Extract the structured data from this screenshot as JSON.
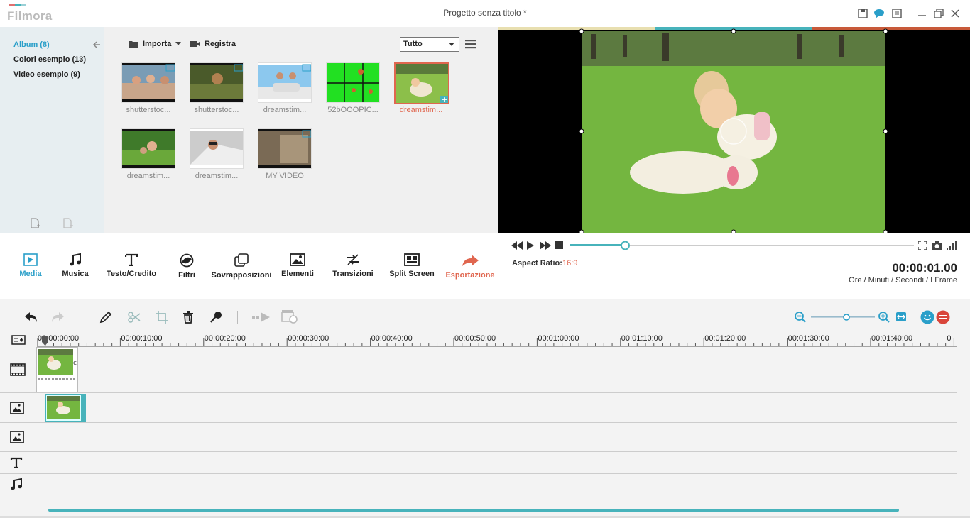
{
  "app": {
    "logo_text": "Filmora",
    "window_title": "Progetto senza titolo *"
  },
  "sidebar": {
    "items": [
      {
        "label": "Album (8)"
      },
      {
        "label": "Colori esempio (13)"
      },
      {
        "label": "Video esempio (9)"
      }
    ]
  },
  "library": {
    "import_label": "Importa",
    "record_label": "Registra",
    "filter_value": "Tutto",
    "items": [
      {
        "label": "shutterstoc..."
      },
      {
        "label": "shutterstoc..."
      },
      {
        "label": "dreamstim..."
      },
      {
        "label": "52bOOOPIC..."
      },
      {
        "label": "dreamstim..."
      },
      {
        "label": "dreamstim..."
      },
      {
        "label": "dreamstim..."
      },
      {
        "label": "MY VIDEO"
      }
    ]
  },
  "toolbar": {
    "items": [
      {
        "label": "Media"
      },
      {
        "label": "Musica"
      },
      {
        "label": "Testo/Credito"
      },
      {
        "label": "Filtri"
      },
      {
        "label": "Sovrapposizioni"
      },
      {
        "label": "Elementi"
      },
      {
        "label": "Transizioni"
      },
      {
        "label": "Split Screen"
      },
      {
        "label": "Esportazione"
      }
    ]
  },
  "player": {
    "aspect_label": "Aspect Ratio:",
    "aspect_value": "16:9",
    "timecode": "00:00:01.00",
    "timecode_caption": "Ore / Minuti / Secondi / I Frame",
    "progress": 0.16
  },
  "timeline": {
    "ruler": [
      "00:00:00:00",
      "00:00:10:00",
      "00:00:20:00",
      "00:00:30:00",
      "00:00:40:00",
      "00:00:50:00",
      "00:01:00:00",
      "00:01:10:00",
      "00:01:20:00",
      "00:01:30:00",
      "00:01:40:00",
      "0"
    ]
  },
  "colors": {
    "accent": "#2a9fc9",
    "export": "#e0664f",
    "timeline_bar": "#47b3bb"
  }
}
